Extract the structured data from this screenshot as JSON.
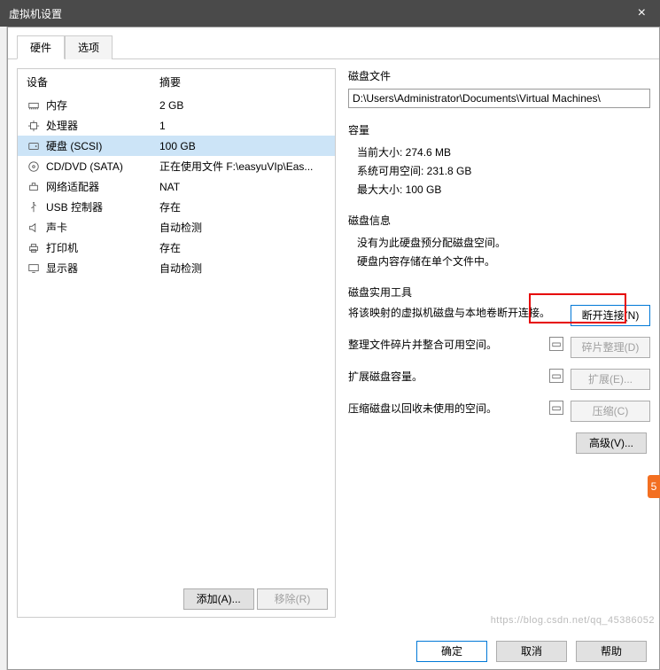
{
  "window": {
    "title": "虚拟机设置",
    "close": "×"
  },
  "tabs": {
    "hardware": "硬件",
    "options": "选项"
  },
  "hw_header": {
    "device": "设备",
    "summary": "摘要"
  },
  "devices": [
    {
      "icon": "memory",
      "name": "内存",
      "summary": "2 GB"
    },
    {
      "icon": "cpu",
      "name": "处理器",
      "summary": "1"
    },
    {
      "icon": "disk",
      "name": "硬盘 (SCSI)",
      "summary": "100 GB",
      "selected": true
    },
    {
      "icon": "cd",
      "name": "CD/DVD (SATA)",
      "summary": "正在使用文件 F:\\easyuVIp\\Eas..."
    },
    {
      "icon": "net",
      "name": "网络适配器",
      "summary": "NAT"
    },
    {
      "icon": "usb",
      "name": "USB 控制器",
      "summary": "存在"
    },
    {
      "icon": "sound",
      "name": "声卡",
      "summary": "自动检测"
    },
    {
      "icon": "printer",
      "name": "打印机",
      "summary": "存在"
    },
    {
      "icon": "display",
      "name": "显示器",
      "summary": "自动检测"
    }
  ],
  "left_buttons": {
    "add": "添加(A)...",
    "remove": "移除(R)"
  },
  "disk_file": {
    "title": "磁盘文件",
    "path": "D:\\Users\\Administrator\\Documents\\Virtual Machines\\"
  },
  "capacity": {
    "title": "容量",
    "current": "当前大小: 274.6 MB",
    "free": "系统可用空间: 231.8 GB",
    "max": "最大大小: 100 GB"
  },
  "disk_info": {
    "title": "磁盘信息",
    "line1": "没有为此硬盘预分配磁盘空间。",
    "line2": "硬盘内容存储在单个文件中。"
  },
  "tools": {
    "title": "磁盘实用工具",
    "disconnect_desc": "将该映射的虚拟机磁盘与本地卷断开连接。",
    "disconnect_btn": "断开连接(N)",
    "defrag_desc": "整理文件碎片并整合可用空间。",
    "defrag_btn": "碎片整理(D)",
    "expand_desc": "扩展磁盘容量。",
    "expand_btn": "扩展(E)...",
    "compact_desc": "压缩磁盘以回收未使用的空间。",
    "compact_btn": "压缩(C)",
    "advanced": "高级(V)..."
  },
  "footer": {
    "ok": "确定",
    "cancel": "取消",
    "help": "帮助"
  },
  "watermark": "https://blog.csdn.net/qq_45386052",
  "badge": "5"
}
